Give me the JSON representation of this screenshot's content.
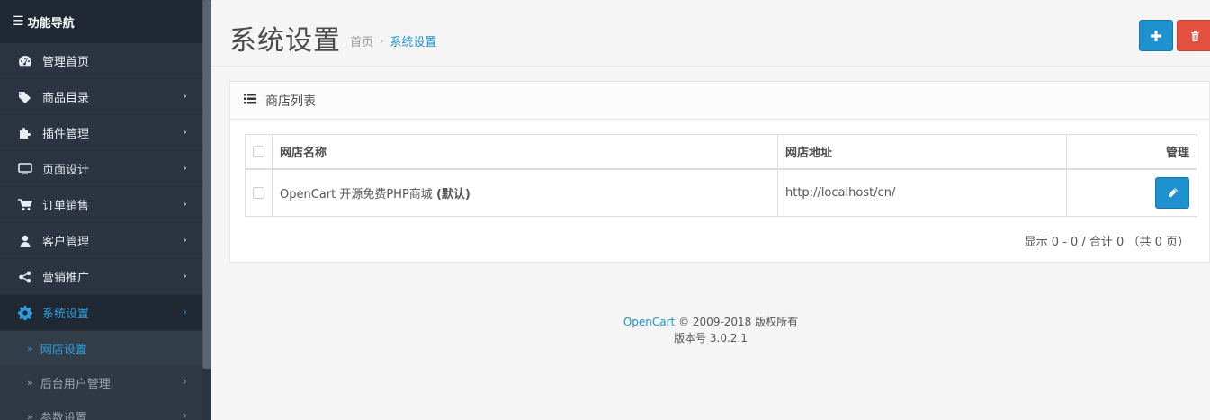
{
  "sidebar": {
    "title": "功能导航",
    "items": [
      {
        "label": "管理首页",
        "icon": "dashboard-icon",
        "expandable": false
      },
      {
        "label": "商品目录",
        "icon": "tags-icon",
        "expandable": true
      },
      {
        "label": "插件管理",
        "icon": "puzzle-icon",
        "expandable": true
      },
      {
        "label": "页面设计",
        "icon": "monitor-icon",
        "expandable": true
      },
      {
        "label": "订单销售",
        "icon": "cart-icon",
        "expandable": true
      },
      {
        "label": "客户管理",
        "icon": "user-icon",
        "expandable": true
      },
      {
        "label": "营销推广",
        "icon": "share-icon",
        "expandable": true
      },
      {
        "label": "系统设置",
        "icon": "gear-icon",
        "expandable": true,
        "active": true
      }
    ],
    "subitems": [
      {
        "label": "网店设置",
        "active": true
      },
      {
        "label": "后台用户管理",
        "expandable": true
      },
      {
        "label": "参数设置",
        "expandable": true
      }
    ]
  },
  "header": {
    "title": "系统设置",
    "breadcrumb": [
      "首页",
      "系统设置"
    ]
  },
  "panel": {
    "title": "商店列表",
    "columns": [
      "网店名称",
      "网店地址",
      "管理"
    ],
    "rows": [
      {
        "name": "OpenCart 开源免费PHP商城",
        "name_suffix": "(默认)",
        "url": "http://localhost/cn/"
      }
    ],
    "pagination": "显示 0 - 0 / 合计 0 （共 0 页）"
  },
  "footer": {
    "brand": "OpenCart",
    "copyright": "© 2009-2018 版权所有",
    "version": "版本号 3.0.2.1"
  },
  "colors": {
    "accent": "#1e91cf",
    "danger": "#e3503e",
    "sidebar_bg": "#2b3542"
  }
}
